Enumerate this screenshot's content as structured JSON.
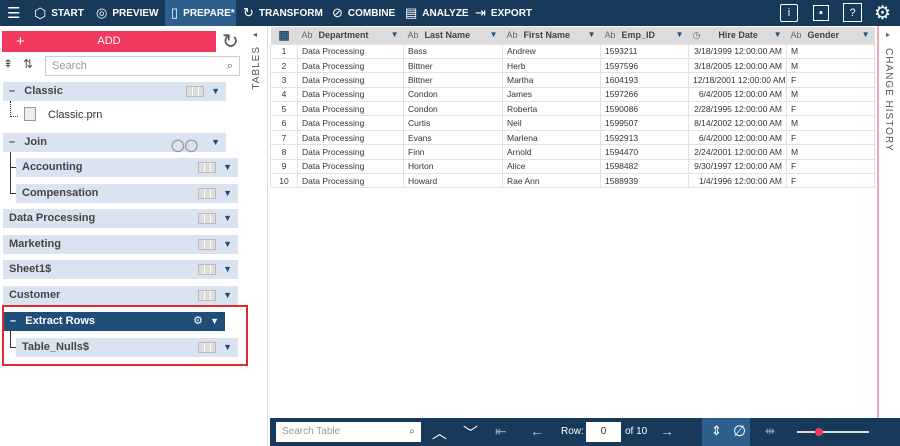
{
  "nav": {
    "items": [
      {
        "label": "START",
        "icon": "cube-icon"
      },
      {
        "label": "PREVIEW",
        "icon": "eye-icon"
      },
      {
        "label": "PREPARE*",
        "icon": "prepare-icon"
      },
      {
        "label": "TRANSFORM",
        "icon": "transform-icon"
      },
      {
        "label": "COMBINE",
        "icon": "combine-icon"
      },
      {
        "label": "ANALYZE",
        "icon": "clipboard-icon"
      },
      {
        "label": "EXPORT",
        "icon": "export-icon"
      }
    ]
  },
  "left": {
    "add_label": "ADD",
    "search_placeholder": "Search",
    "tree": {
      "classic": "Classic",
      "classic_file": "Classic.prn",
      "join": "Join",
      "accounting": "Accounting",
      "compensation": "Compensation",
      "data_processing": "Data Processing",
      "marketing": "Marketing",
      "sheet1": "Sheet1$",
      "customer": "Customer",
      "extract_rows": "Extract Rows",
      "table_nulls": "Table_Nulls$"
    }
  },
  "tables_label": "TABLES",
  "change_history_label": "CHANGE HISTORY",
  "grid": {
    "type_text": "Ab",
    "columns": [
      "Department",
      "Last Name",
      "First Name",
      "Emp_ID",
      "Hire Date",
      "Gender"
    ],
    "rows": [
      [
        "1",
        "Data Processing",
        "Bass",
        "Andrew",
        "1593211",
        "3/18/1999 12:00:00 AM",
        "M"
      ],
      [
        "2",
        "Data Processing",
        "Bittner",
        "Herb",
        "1597596",
        "3/18/2005 12:00:00 AM",
        "M"
      ],
      [
        "3",
        "Data Processing",
        "Bittner",
        "Martha",
        "1604193",
        "12/18/2001 12:00:00 AM",
        "F"
      ],
      [
        "4",
        "Data Processing",
        "Condon",
        "James",
        "1597266",
        "6/4/2005 12:00:00 AM",
        "M"
      ],
      [
        "5",
        "Data Processing",
        "Condon",
        "Roberta",
        "1590086",
        "2/28/1995 12:00:00 AM",
        "F"
      ],
      [
        "6",
        "Data Processing",
        "Curtis",
        "Neil",
        "1599507",
        "8/14/2002 12:00:00 AM",
        "M"
      ],
      [
        "7",
        "Data Processing",
        "Evans",
        "Marlena",
        "1592913",
        "6/4/2000 12:00:00 AM",
        "F"
      ],
      [
        "8",
        "Data Processing",
        "Finn",
        "Arnold",
        "1594470",
        "2/24/2001 12:00:00 AM",
        "M"
      ],
      [
        "9",
        "Data Processing",
        "Horton",
        "Alice",
        "1598482",
        "9/30/1997 12:00:00 AM",
        "F"
      ],
      [
        "10",
        "Data Processing",
        "Howard",
        "Rae Ann",
        "1588939",
        "1/4/1996 12:00:00 AM",
        "F"
      ]
    ]
  },
  "bottom": {
    "search_placeholder": "Search Table",
    "row_label": "Row:",
    "row_value": "0",
    "of_label": "of 10",
    "zoom_fraction": 0.3
  },
  "colors": {
    "navy": "#183a5a",
    "accent": "#f2385f",
    "active": "#2e5f8c"
  }
}
